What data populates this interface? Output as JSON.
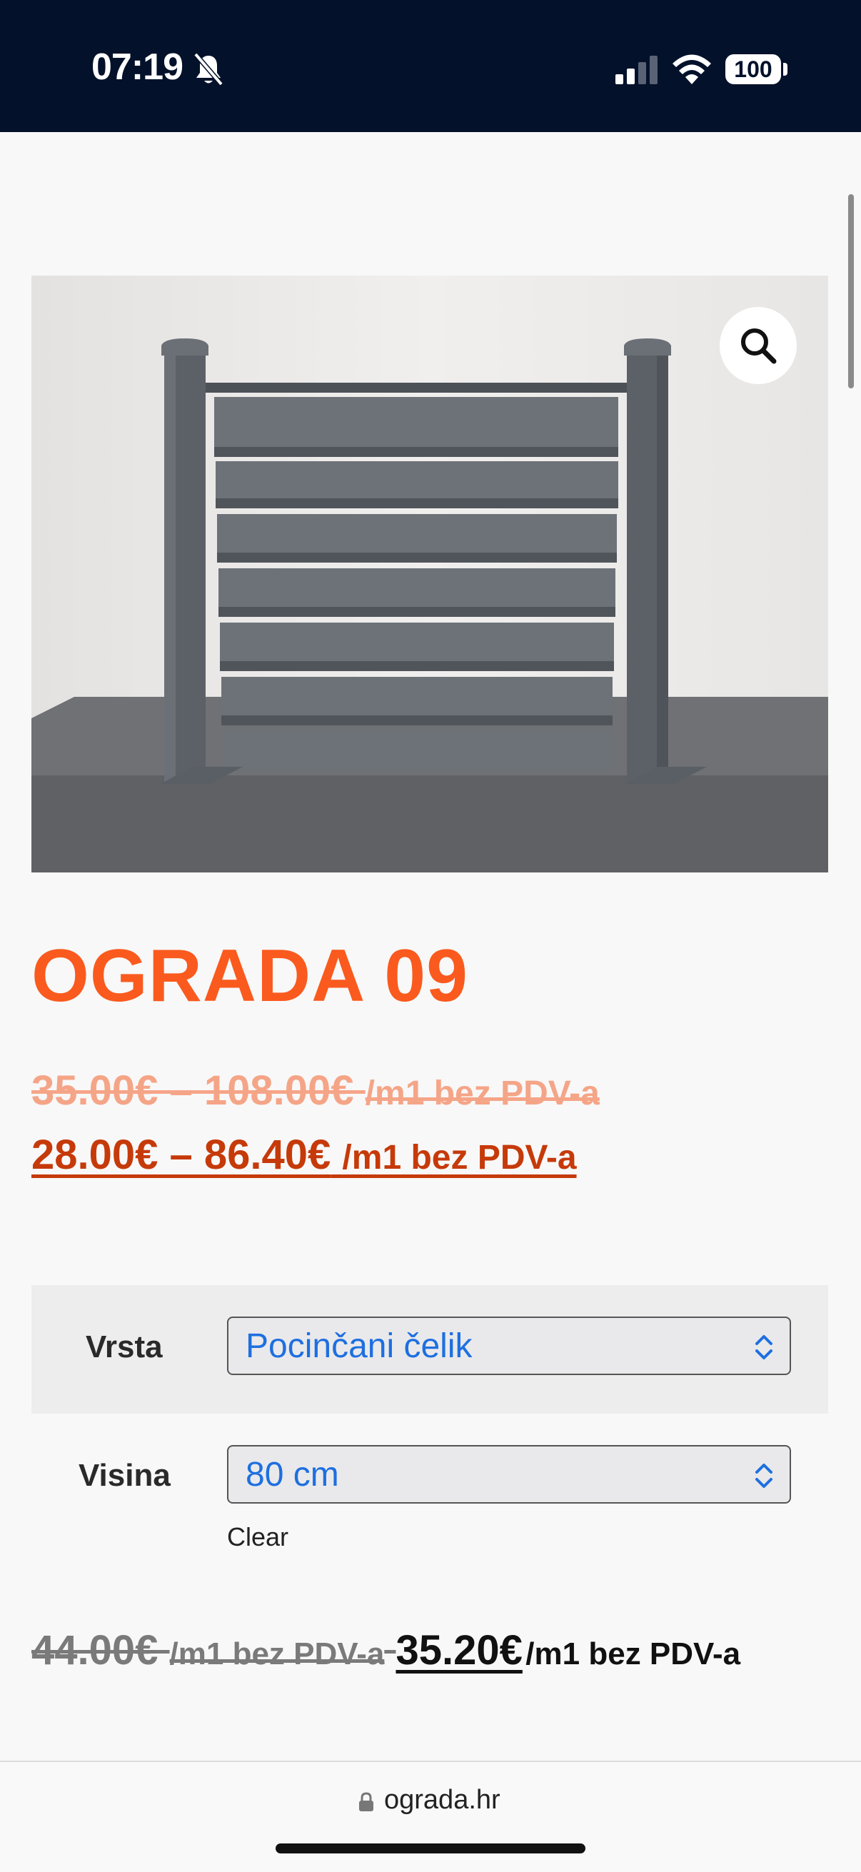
{
  "status_bar": {
    "time": "07:19",
    "battery": "100"
  },
  "product": {
    "title": "OGRADA 09",
    "image_alt": "Ograda 09 fence panel",
    "price_old_range": "35.00€ – 108.00€",
    "price_new_range": "28.00€ – 86.40€",
    "price_suffix": "/m1 bez PDV-a"
  },
  "variations": {
    "type_label": "Vrsta",
    "type_value": "Pocinčani čelik",
    "height_label": "Visina",
    "height_value": "80 cm",
    "clear_label": "Clear"
  },
  "variation_price": {
    "old": "44.00€",
    "old_suffix": "/m1 bez PDV-a",
    "new": "35.20€",
    "new_suffix": "/m1 bez PDV-a"
  },
  "browser": {
    "url": "ograda.hr"
  },
  "colors": {
    "accent": "#fa5a1e",
    "price_new": "#c63a0a",
    "select_text": "#1e6fe0",
    "status_bar_bg": "#03112a"
  },
  "icons": [
    "bell-slash-icon",
    "signal-icon",
    "wifi-icon",
    "battery-icon",
    "search-icon",
    "chevron-updown-icon",
    "lock-icon"
  ]
}
